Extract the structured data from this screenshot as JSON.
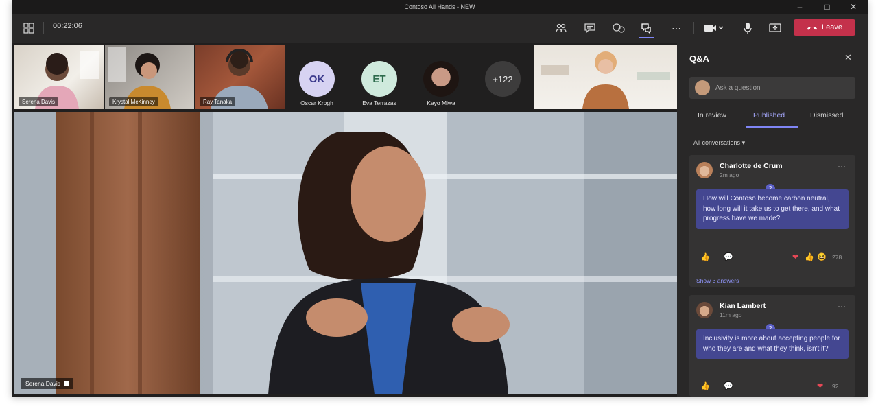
{
  "window": {
    "title": "Contoso All Hands - NEW"
  },
  "toolbar": {
    "timer": "00:22:06",
    "leave_label": "Leave",
    "icons": [
      "grid-icon",
      "people-icon",
      "chat-icon",
      "reactions-icon",
      "qa-icon",
      "more-icon",
      "camera-icon",
      "mic-icon",
      "share-icon",
      "hangup-icon"
    ]
  },
  "participants": [
    {
      "name": "Serena Davis"
    },
    {
      "name": "Krystal McKinney"
    },
    {
      "name": "Ray Tanaka"
    },
    {
      "name": "Oscar Krogh",
      "initials": "OK"
    },
    {
      "name": "Eva Terrazas",
      "initials": "ET"
    },
    {
      "name": "Kayo Miwa"
    }
  ],
  "overflow_count": "+122",
  "stage": {
    "speaker": "Serena Davis"
  },
  "qa": {
    "title": "Q&A",
    "ask_placeholder": "Ask a question",
    "tabs": [
      "In review",
      "Published",
      "Dismissed"
    ],
    "active_tab": "Published",
    "filter": "All conversations",
    "questions": [
      {
        "author": "Charlotte de Crum",
        "time": "2m ago",
        "text": "How will Contoso become carbon neutral, how long will it take us to get there, and what progress have we made?",
        "count": "278",
        "answers": "Show 3 answers"
      },
      {
        "author": "Kian Lambert",
        "time": "11m ago",
        "text": "Inclusivity is more about accepting people for who they are and what they think, isn't it?",
        "count": "92"
      }
    ]
  },
  "colors": {
    "accent": "#7f85f5",
    "leave": "#c4314b",
    "question_bubble": "#444791"
  }
}
